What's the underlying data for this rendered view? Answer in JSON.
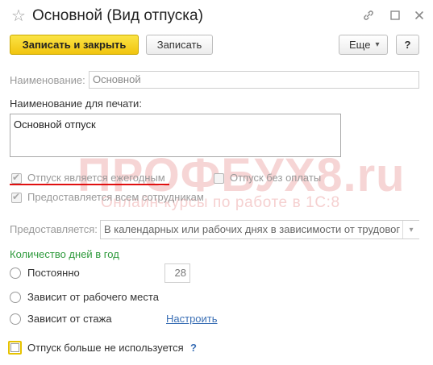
{
  "window": {
    "title": "Основной (Вид отпуска)",
    "icons": [
      "star-icon",
      "link-icon",
      "maximize-icon",
      "close-icon"
    ]
  },
  "toolbar": {
    "save_close_label": "Записать и закрыть",
    "save_label": "Записать",
    "more_label": "Еще",
    "more_arrow": "▾",
    "help_label": "?"
  },
  "form": {
    "name_label": "Наименование:",
    "name_value": "Основной",
    "print_name_label": "Наименование для печати:",
    "print_name_value": "Основной отпуск",
    "annual_label": "Отпуск является ежегодным",
    "annual_checked": true,
    "unpaid_label": "Отпуск без оплаты",
    "unpaid_checked": false,
    "all_employees_label": "Предоставляется всем сотрудникам",
    "all_employees_checked": true,
    "provided_label": "Предоставляется:",
    "provided_value": "В календарных или рабочих днях в зависимости от трудовог",
    "days_section_label": "Количество дней в год",
    "radio_constant_label": "Постоянно",
    "constant_days": "28",
    "radio_workplace_label": "Зависит от рабочего места",
    "radio_seniority_label": "Зависит от стажа",
    "configure_link": "Настроить",
    "not_used_label": "Отпуск больше не используется",
    "not_used_help": "?"
  },
  "watermark": {
    "brand": "ПРОФБУХ8.ru",
    "tagline": "Онлайн-курсы по работе в 1С:8"
  },
  "colors": {
    "primary_button": "#f5d32a",
    "section_heading": "#2e9a3c",
    "link": "#3a6fb5",
    "annotation_underline": "#e01010",
    "watermark": "#f3c0c0"
  }
}
